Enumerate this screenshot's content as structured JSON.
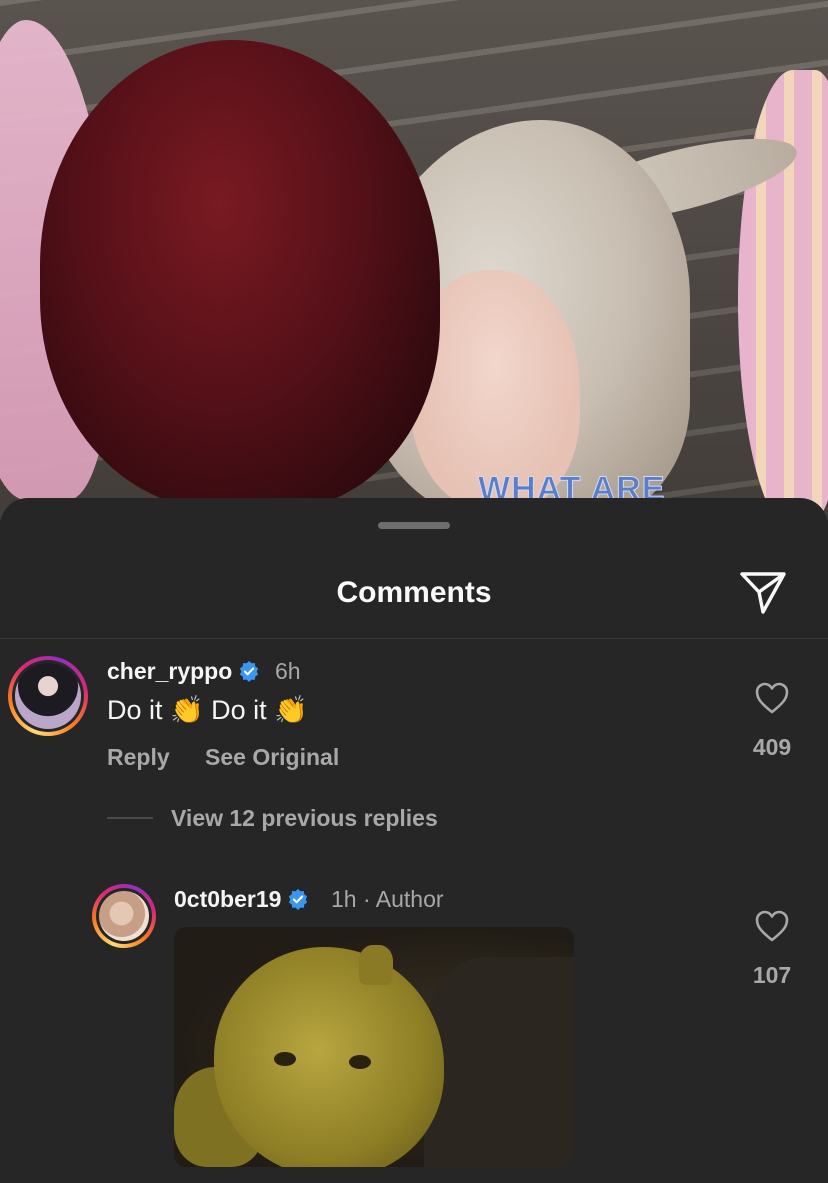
{
  "post": {
    "overlay_text": "WHAT ARE"
  },
  "sheet": {
    "title": "Comments",
    "share_icon": "paper-plane-icon"
  },
  "comments": [
    {
      "username": "cher_ryppo",
      "verified": true,
      "time": "6h",
      "text": "Do it 👏 Do it 👏",
      "actions": [
        "Reply",
        "See Original"
      ],
      "likes": "409"
    }
  ],
  "thread": {
    "view_replies_label": "View 12 previous replies"
  },
  "replies": [
    {
      "username": "0ct0ber19",
      "verified": true,
      "time": "1h",
      "separator": "·",
      "author_label": "Author",
      "attachment": "gif",
      "likes": "107"
    }
  ],
  "colors": {
    "background": "#262626",
    "verified_blue": "#3897f0",
    "secondary_text": "#a8a8a8"
  }
}
